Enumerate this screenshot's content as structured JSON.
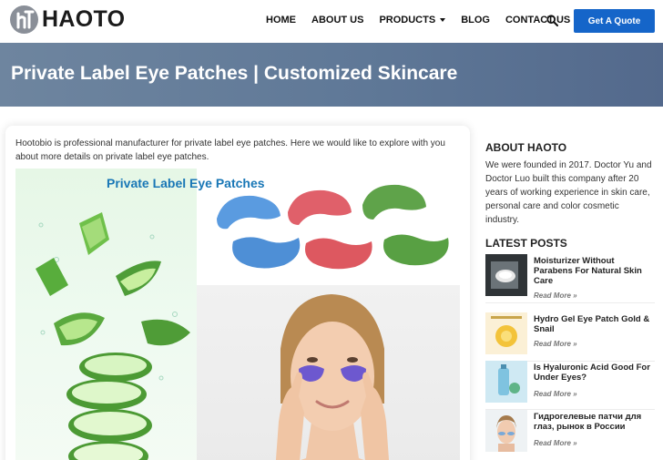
{
  "header": {
    "logo_text": "HAOTO",
    "nav": [
      {
        "label": "HOME"
      },
      {
        "label": "ABOUT US"
      },
      {
        "label": "PRODUCTS"
      },
      {
        "label": "BLOG"
      },
      {
        "label": "CONTACT US"
      }
    ],
    "quote_button": "Get A Quote",
    "icons": {
      "search": "search-icon",
      "products_dropdown": "caret-down-icon"
    },
    "colors": {
      "accent": "#1565c9"
    }
  },
  "banner": {
    "title": "Private Label Eye Patches | Customized Skincare",
    "color": "#5f7897"
  },
  "article": {
    "intro": "Hootobio is professional manufacturer for private label eye patches. Here we would like to explore with you about more details on private label eye patches.",
    "hero_title": "Private Label Eye Patches"
  },
  "sidebar": {
    "about_title": "ABOUT HAOTO",
    "about_text": "We were founded in 2017. Doctor Yu and Doctor Luo built this company after 20 years of working experience in skin care, personal care and color cosmetic industry.",
    "latest_title": "LATEST POSTS",
    "posts": [
      {
        "title": "Moisturizer Without Parabens For Natural Skin Care",
        "more": "Read More »"
      },
      {
        "title": "Hydro Gel Eye Patch Gold & Snail",
        "more": "Read More »"
      },
      {
        "title": "Is Hyaluronic Acid Good For Under Eyes?",
        "more": "Read More »"
      },
      {
        "title": "Гидрогелевые патчи для глаз, рынок в России",
        "more": "Read More »"
      }
    ]
  }
}
